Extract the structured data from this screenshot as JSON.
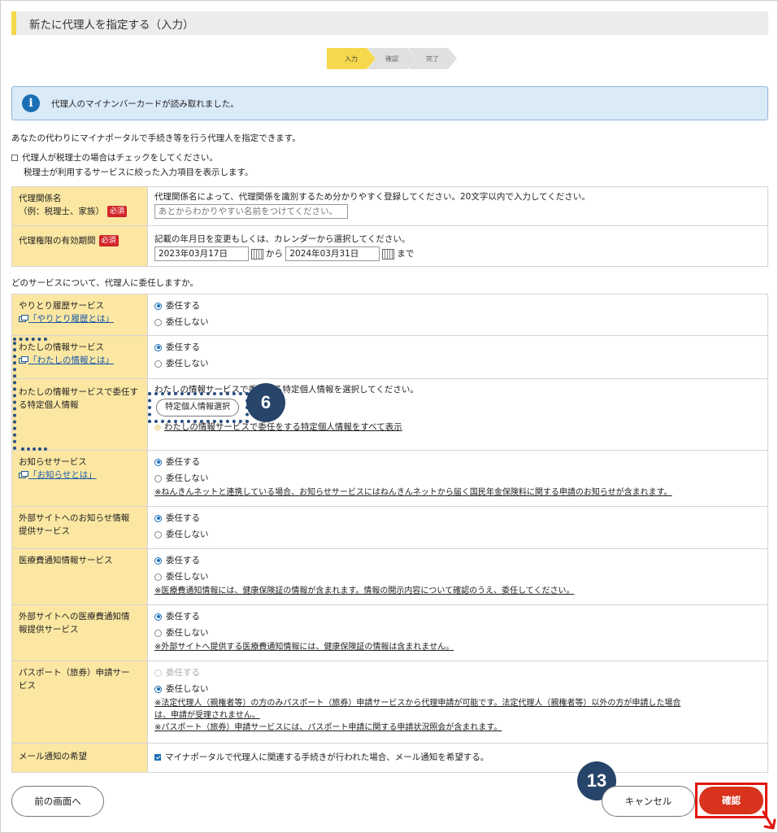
{
  "page": {
    "title": "新たに代理人を指定する（入力）",
    "steps": [
      "入力",
      "確認",
      "完了"
    ]
  },
  "info": {
    "icon": "info-icon",
    "message": "代理人のマイナンバーカードが読み取れました。"
  },
  "intro": "あなたの代わりにマイナポータルで手続き等を行う代理人を指定できます。",
  "tax_checkbox": {
    "label": "代理人が税理士の場合はチェックをしてください。",
    "sub": "税理士が利用するサービスに絞った入力項目を表示します。"
  },
  "relation": {
    "label1": "代理関係名",
    "label2": "（例：税理士、家族）",
    "required": "必須",
    "desc": "代理関係名によって、代理関係を識別するため分かりやすく登録してください。20文字以内で入力してください。",
    "placeholder": "あとからわかりやすい名前をつけてください。"
  },
  "period": {
    "label": "代理権限の有効期間",
    "required": "必須",
    "desc": "記載の年月日を変更もしくは、カレンダーから選択してください。",
    "from": "2023年03月17日",
    "from_suffix": "から",
    "to": "2024年03月31日",
    "to_suffix": "まで"
  },
  "services_question": "どのサービスについて、代理人に委任しますか。",
  "options": {
    "delegate": "委任する",
    "no_delegate": "委任しない"
  },
  "services": {
    "history": {
      "label": "やりとり履歴サービス",
      "link": "「やりとり履歴とは」"
    },
    "myinfo": {
      "label": "わたしの情報サービス",
      "link": "「わたしの情報とは」"
    },
    "specific": {
      "label": "わたしの情報サービスで委任する特定個人情報",
      "desc": "わたしの情報サービスで委任する特定個人情報を選択してください。",
      "button": "特定個人情報選択",
      "show_all": "わたしの情報サービスで委任をする特定個人情報をすべて表示"
    },
    "notice": {
      "label": "お知らせサービス",
      "link": "「お知らせとは」",
      "note": "※ねんきんネットと連携している場合、お知らせサービスにはねんきんネットから届く国民年金保険料に関する申請のお知らせが含まれます。"
    },
    "external_notice": {
      "label1": "外部サイトへのお知らせ情報",
      "label2": "提供サービス"
    },
    "medical": {
      "label": "医療費通知情報サービス",
      "note": "※医療費通知情報には、健康保険証の情報が含まれます。情報の開示内容について確認のうえ、委任してください。"
    },
    "external_medical": {
      "label1": "外部サイトへの医療費通知情",
      "label2": "報提供サービス",
      "note": "※外部サイトへ提供する医療費通知情報には、健康保険証の情報は含まれません。"
    },
    "passport": {
      "label1": "パスポート（旅券）申請サー",
      "label2": "ビス",
      "note1": "※法定代理人（親権者等）の方のみパスポート（旅券）申請サービスから代理申請が可能です。法定代理人（親権者等）以外の方が申請した場合",
      "note2": "は、申請が受理されません。",
      "note3": "※パスポート（旅券）申請サービスには、パスポート申請に関する申請状況照会が含まれます。"
    },
    "mail": {
      "label": "メール通知の希望",
      "checkbox": "マイナポータルで代理人に関連する手続きが行われた場合、メール通知を希望する。"
    }
  },
  "annotations": {
    "badge6": "6",
    "badge13": "13"
  },
  "buttons": {
    "back": "前の画面へ",
    "cancel": "キャンセル",
    "confirm": "確認"
  },
  "colors": {
    "accent_yellow": "#f5d84b",
    "label_bg": "#fbe7a2",
    "info_blue": "#1b6fb5",
    "confirm_red": "#d8331c",
    "annotation_navy": "#27456b"
  }
}
